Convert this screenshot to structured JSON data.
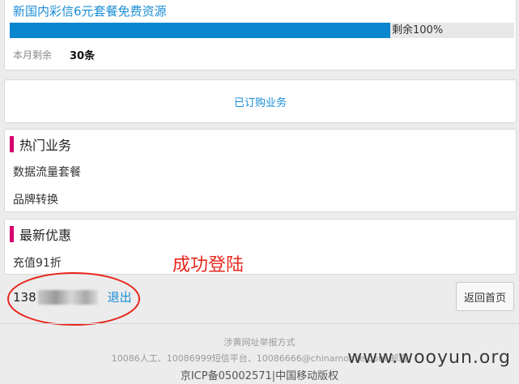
{
  "package": {
    "title": "新国内彩信6元套餐免费资源",
    "progress_percent": 100,
    "progress_text": "剩余100%",
    "remain_label": "本月剩余",
    "remain_value": "30条"
  },
  "subscribed": {
    "label": "已订购业务"
  },
  "hot": {
    "title": "热门业务",
    "items": [
      "数据流量套餐",
      "品牌转换"
    ]
  },
  "promo": {
    "title": "最新优惠",
    "items": [
      "充值91折"
    ]
  },
  "overlay": {
    "text": "成功登陆"
  },
  "user": {
    "phone_prefix": "138",
    "logout_label": "退出"
  },
  "home_button": {
    "label": "返回首页"
  },
  "footer": {
    "report_link": "涉黄网址举报方式",
    "contact": "10086人工、10086999短信平台、10086666@chinamobile.com 邮箱",
    "copyright": "京ICP备05002571|中国移动版权"
  },
  "watermark": {
    "text": "www.wooyun.org"
  },
  "colors": {
    "accent_blue": "#1a8dd6",
    "progress_fill": "#0a86cf",
    "section_bar": "#d6006f",
    "annotation_red": "#e8271d"
  }
}
